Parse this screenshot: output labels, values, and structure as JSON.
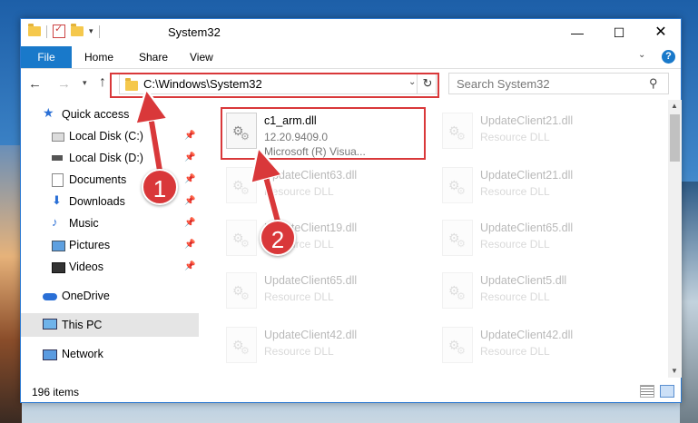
{
  "window": {
    "title": "System32"
  },
  "title_buttons": {
    "minimize": "—",
    "maximize": "☐",
    "close": "✕"
  },
  "ribbon": {
    "tabs": [
      "File",
      "Home",
      "Share",
      "View"
    ]
  },
  "navbar": {
    "back": "←",
    "forward": "→",
    "up": "↑",
    "address": "C:\\Windows\\System32",
    "refresh": "↻",
    "search_placeholder": "Search System32"
  },
  "sidebar": {
    "items": [
      {
        "label": "Quick access",
        "icon": "star-icon"
      },
      {
        "label": "Local Disk (C:)",
        "icon": "drive-icon",
        "pinned": true
      },
      {
        "label": "Local Disk (D:)",
        "icon": "drive-icon",
        "pinned": true
      },
      {
        "label": "Documents",
        "icon": "document-icon",
        "pinned": true
      },
      {
        "label": "Downloads",
        "icon": "download-icon",
        "pinned": true
      },
      {
        "label": "Music",
        "icon": "music-icon",
        "pinned": true
      },
      {
        "label": "Pictures",
        "icon": "pictures-icon",
        "pinned": true
      },
      {
        "label": "Videos",
        "icon": "video-icon",
        "pinned": true
      },
      {
        "label": "OneDrive",
        "icon": "cloud-icon"
      },
      {
        "label": "This PC",
        "icon": "computer-icon",
        "selected": true
      },
      {
        "label": "Network",
        "icon": "network-icon"
      }
    ]
  },
  "files": [
    {
      "name": "c1_arm.dll",
      "line2": "12.20.9409.0",
      "line3": "Microsoft (R) Visua...",
      "faded": false
    },
    {
      "name": "UpdateClient21.dll",
      "line2": "Resource DLL",
      "faded": true
    },
    {
      "name": "UpdateClient63.dll",
      "line2": "Resource DLL",
      "faded": true
    },
    {
      "name": "UpdateClient21.dll",
      "line2": "Resource DLL",
      "faded": true
    },
    {
      "name": "UpdateClient19.dll",
      "line2": "Resource DLL",
      "faded": true
    },
    {
      "name": "UpdateClient65.dll",
      "line2": "Resource DLL",
      "faded": true
    },
    {
      "name": "UpdateClient65.dll",
      "line2": "Resource DLL",
      "faded": true
    },
    {
      "name": "UpdateClient5.dll",
      "line2": "Resource DLL",
      "faded": true
    },
    {
      "name": "UpdateClient42.dll",
      "line2": "Resource DLL",
      "faded": true
    },
    {
      "name": "UpdateClient42.dll",
      "line2": "Resource DLL",
      "faded": true
    }
  ],
  "status": {
    "item_count": "196 items"
  },
  "annotations": {
    "step1": "1",
    "step2": "2",
    "color": "#d9383a"
  },
  "colors": {
    "accent": "#1979ca",
    "highlight": "#d9383a"
  }
}
